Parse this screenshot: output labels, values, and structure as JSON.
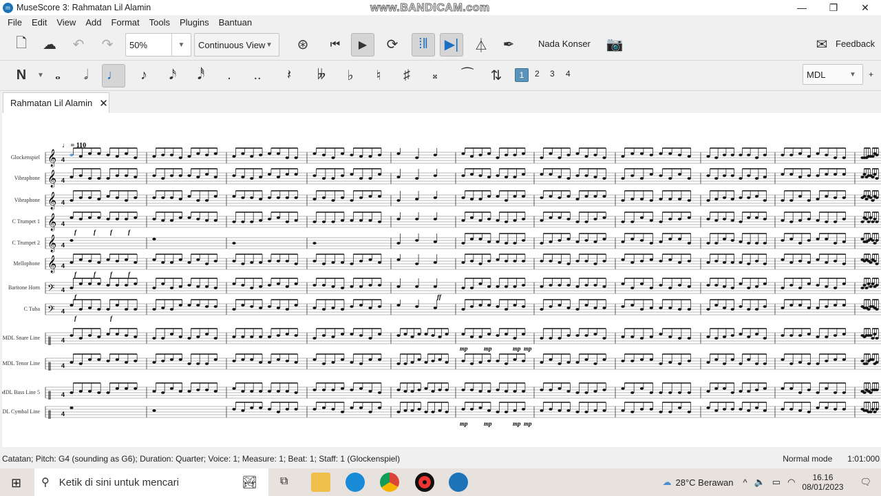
{
  "window": {
    "title": "MuseScore 3: Rahmatan Lil Alamin",
    "watermark": "www.BANDICAM.com"
  },
  "menu": [
    "File",
    "Edit",
    "View",
    "Add",
    "Format",
    "Tools",
    "Plugins",
    "Bantuan"
  ],
  "toolbar": {
    "zoom": "50%",
    "view_mode": "Continuous View",
    "concert_pitch": "Nada Konser",
    "feedback": "Feedback"
  },
  "notebar": {
    "voices": [
      "1",
      "2",
      "3",
      "4"
    ],
    "active_voice": "1",
    "workspace": "MDL",
    "plus": "+"
  },
  "tab": {
    "label": "Rahmatan Lil Alamin"
  },
  "score": {
    "tempo": "♩ = 110",
    "instruments": [
      "Glockenspiel",
      "Vibraphone",
      "Vibraphone",
      "C Trumpet 1",
      "C Trumpet 2",
      "Mellophone",
      "Baritone Horn",
      "C Tuba",
      "MDL Snare Line",
      "MDL Tenor Line",
      "MDL Bass Line 5",
      "MDL Cymbal Line"
    ],
    "dynamic_f": "f",
    "dynamic_ff": "ff",
    "dynamic_mp": "mp"
  },
  "status": {
    "text": "Catatan; Pitch: G4 (sounding as G6); Duration: Quarter; Voice: 1;  Measure: 1; Beat: 1; Staff: 1 (Glockenspiel)",
    "mode": "Normal mode",
    "time": "1:01:000"
  },
  "taskbar": {
    "search_placeholder": "Ketik di sini untuk mencari",
    "weather": "28°C  Berawan",
    "time": "16.16",
    "date": "08/01/2023"
  }
}
